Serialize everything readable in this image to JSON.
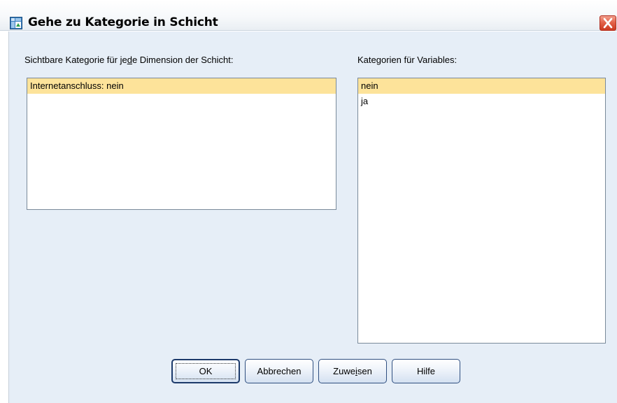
{
  "window": {
    "title": "Gehe zu Kategorie in Schicht",
    "icon": "table-pivot-icon",
    "close_icon": "close-icon"
  },
  "left_panel": {
    "label_parts": [
      "Sichtbare Kategorie für je",
      "d",
      "e Dimension der Schicht:"
    ],
    "items": [
      {
        "label": "Internetanschluss: nein",
        "selected": true
      }
    ]
  },
  "right_panel": {
    "label": "Kategorien für Variables:",
    "items": [
      {
        "label": "nein",
        "selected": true
      },
      {
        "label": "ja",
        "selected": false
      }
    ]
  },
  "buttons": {
    "ok": "OK",
    "cancel": "Abbrechen",
    "assign_parts": [
      "Zuwe",
      "i",
      "sen"
    ],
    "help": "Hilfe"
  },
  "colors": {
    "selection": "#fde39a",
    "client_background": "#e6eef7",
    "close_button": "#d9472d",
    "button_border": "#2f4f80"
  }
}
